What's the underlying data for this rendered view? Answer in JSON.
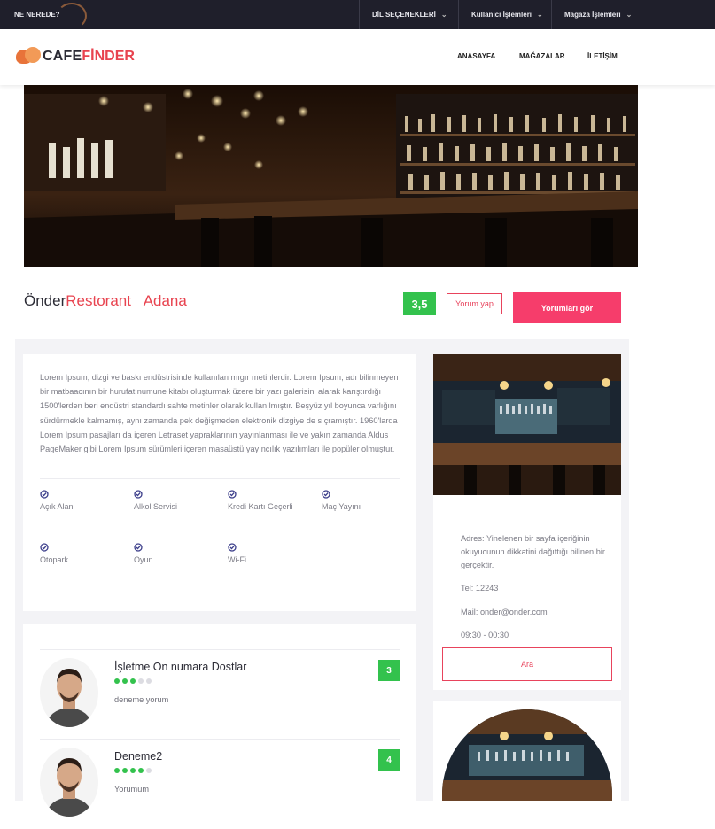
{
  "topbar": {
    "brand_question": "NE NEREDE?",
    "menus": [
      {
        "label": "DİL SEÇENEKLERİ"
      },
      {
        "label": "Kullanıcı İşlemleri"
      },
      {
        "label": "Mağaza İşlemleri"
      }
    ]
  },
  "header": {
    "logo_part1": "CAFE",
    "logo_part2": "FİNDER",
    "nav": [
      "ANASAYFA",
      "MAĞAZALAR",
      "İLETİŞİM"
    ]
  },
  "place": {
    "name_part1": "Önder",
    "name_part2": "Restorant",
    "city": "Adana",
    "rating": "3,5",
    "write_review_label": "Yorum yap",
    "see_reviews_label": "Yorumları gör"
  },
  "description": "Lorem Ipsum, dizgi ve baskı endüstrisinde kullanılan mıgır metinlerdir. Lorem Ipsum, adı bilinmeyen bir matbaacının bir hurufat numune kitabı oluşturmak üzere bir yazı galerisini alarak karıştırdığı 1500'lerden beri endüstri standardı sahte metinler olarak kullanılmıştır. Beşyüz yıl boyunca varlığını sürdürmekle kalmamış, aynı zamanda pek değişmeden elektronik dizgiye de sıçramıştır. 1960'larda Lorem Ipsum pasajları da içeren Letraset yapraklarının yayınlanması ile ve yakın zamanda Aldus PageMaker gibi Lorem Ipsum sürümleri içeren masaüstü yayıncılık yazılımları ile popüler olmuştur.",
  "features": [
    "Açık Alan",
    "Alkol Servisi",
    "Kredi Kartı Geçerli",
    "Maç Yayını",
    "Otopark",
    "Oyun",
    "Wi-Fi"
  ],
  "contact": {
    "address": "Adres: Yinelenen bir sayfa içeriğinin okuyucunun dikkatini dağıttığı bilinen bir gerçektir.",
    "tel": "Tel: 12243",
    "mail": "Mail: onder@onder.com",
    "hours": "09:30 - 00:30",
    "call_label": "Ara"
  },
  "reviews": [
    {
      "name": "İşletme On numara Dostlar",
      "text": "deneme yorum",
      "score": "3",
      "stars": 3
    },
    {
      "name": "Deneme2",
      "text": "Yorumum",
      "score": "4",
      "stars": 4
    }
  ],
  "colors": {
    "accent_pink": "#f63d6b",
    "accent_red": "#e8434f",
    "score_green": "#33c24d",
    "topbar": "#1f1f2b"
  }
}
